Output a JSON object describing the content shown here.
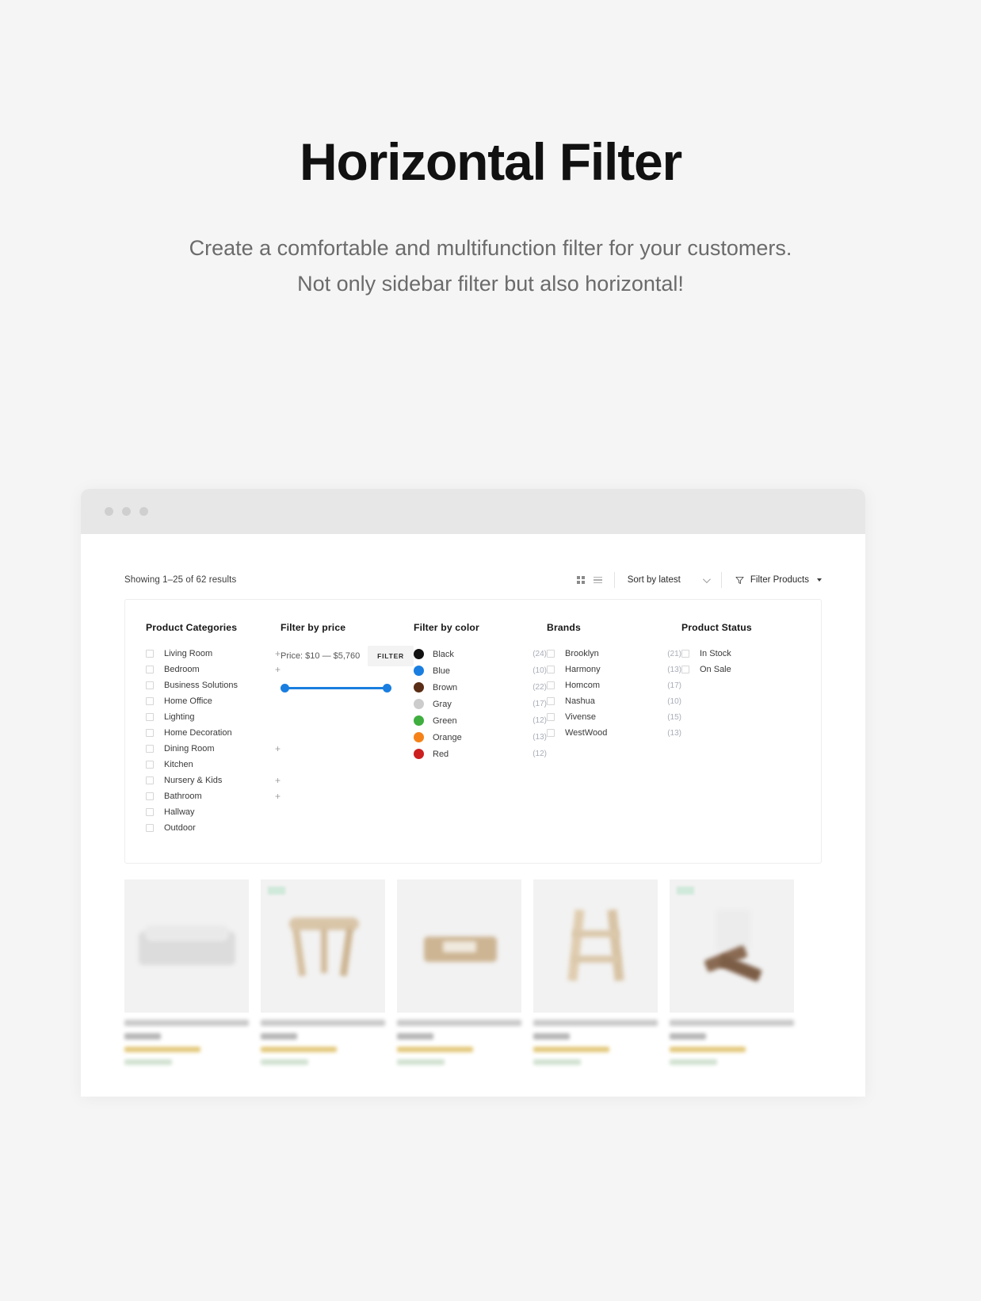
{
  "hero": {
    "title": "Horizontal Filter",
    "subtitle_line1": "Create a comfortable and multifunction filter for your customers.",
    "subtitle_line2": "Not only sidebar filter but also horizontal!"
  },
  "browser": {
    "dots": [
      "traffic-light-red",
      "traffic-light-yellow",
      "traffic-light-green"
    ]
  },
  "toolbar": {
    "showing": "Showing 1–25 of 62 results",
    "grid_view_icon": "grid-view-icon",
    "list_view_icon": "list-view-icon",
    "sort_value": "Sort by latest",
    "sort_chevron_icon": "chevron-down-icon",
    "filter_products_label": "Filter Products",
    "funnel_icon": "funnel-icon",
    "caret_icon": "caret-down-icon"
  },
  "filters": {
    "categories": {
      "title": "Product Categories",
      "items": [
        {
          "label": "Living Room",
          "expandable": "+"
        },
        {
          "label": "Bedroom",
          "expandable": "+"
        },
        {
          "label": "Business Solutions",
          "expandable": ""
        },
        {
          "label": "Home Office",
          "expandable": ""
        },
        {
          "label": "Lighting",
          "expandable": ""
        },
        {
          "label": "Home Decoration",
          "expandable": ""
        },
        {
          "label": "Dining Room",
          "expandable": "+"
        },
        {
          "label": "Kitchen",
          "expandable": ""
        },
        {
          "label": "Nursery & Kids",
          "expandable": "+"
        },
        {
          "label": "Bathroom",
          "expandable": "+"
        },
        {
          "label": "Hallway",
          "expandable": ""
        },
        {
          "label": "Outdoor",
          "expandable": ""
        }
      ]
    },
    "price": {
      "title": "Filter by price",
      "range_text": "Price: $10 — $5,760",
      "button_label": "FILTER",
      "min": 10,
      "max": 5760,
      "accent": "#1a7ee0"
    },
    "color": {
      "title": "Filter by color",
      "items": [
        {
          "label": "Black",
          "count": "(24)",
          "hex": "#111111"
        },
        {
          "label": "Blue",
          "count": "(10)",
          "hex": "#1a7ee0"
        },
        {
          "label": "Brown",
          "count": "(22)",
          "hex": "#5a2d16"
        },
        {
          "label": "Gray",
          "count": "(17)",
          "hex": "#cccccc"
        },
        {
          "label": "Green",
          "count": "(12)",
          "hex": "#3eae3e"
        },
        {
          "label": "Orange",
          "count": "(13)",
          "hex": "#f58219"
        },
        {
          "label": "Red",
          "count": "(12)",
          "hex": "#cc1f1f"
        }
      ]
    },
    "brands": {
      "title": "Brands",
      "items": [
        {
          "label": "Brooklyn",
          "count": "(21)"
        },
        {
          "label": "Harmony",
          "count": "(13)"
        },
        {
          "label": "Homcom",
          "count": "(17)"
        },
        {
          "label": "Nashua",
          "count": "(10)"
        },
        {
          "label": "Vivense",
          "count": "(15)"
        },
        {
          "label": "WestWood",
          "count": "(13)"
        }
      ]
    },
    "status": {
      "title": "Product Status",
      "items": [
        {
          "label": "In Stock"
        },
        {
          "label": "On Sale"
        }
      ]
    }
  },
  "products": [
    {
      "has_badge": false,
      "kind": "sofa"
    },
    {
      "has_badge": true,
      "kind": "stool"
    },
    {
      "has_badge": false,
      "kind": "table"
    },
    {
      "has_badge": false,
      "kind": "chair"
    },
    {
      "has_badge": true,
      "kind": "lamp"
    }
  ]
}
